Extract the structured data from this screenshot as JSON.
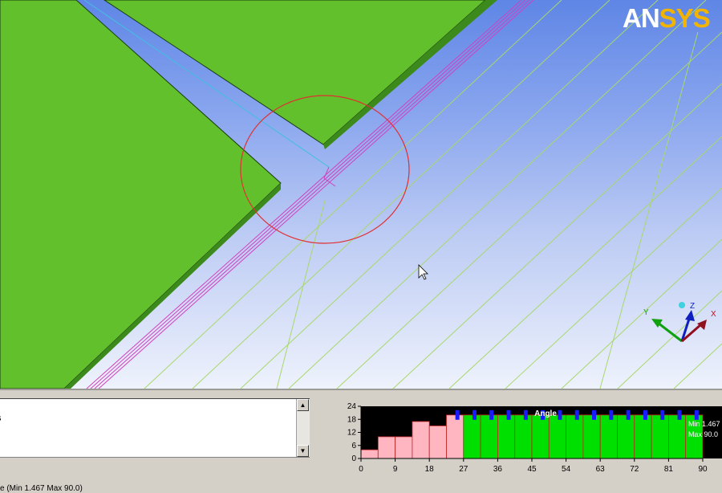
{
  "logo": {
    "part1": "AN",
    "part2": "SYS"
  },
  "log": {
    "line1": "s"
  },
  "status": {
    "text": "e (Min 1.467 Max 90.0)"
  },
  "chart_data": {
    "type": "bar",
    "title": "Angle",
    "x_ticks": [
      0,
      9,
      18,
      27,
      36,
      45,
      54,
      63,
      72,
      81,
      90
    ],
    "y_ticks": [
      0,
      6,
      12,
      18,
      24
    ],
    "xlim": [
      0,
      90
    ],
    "ylim": [
      0,
      24
    ],
    "bins": [
      {
        "from": 0,
        "to": 4.5,
        "value": 4,
        "color": "pink"
      },
      {
        "from": 4.5,
        "to": 9,
        "value": 10,
        "color": "pink"
      },
      {
        "from": 9,
        "to": 13.5,
        "value": 10,
        "color": "pink"
      },
      {
        "from": 13.5,
        "to": 18,
        "value": 17,
        "color": "pink"
      },
      {
        "from": 18,
        "to": 22.5,
        "value": 15,
        "color": "pink"
      },
      {
        "from": 22.5,
        "to": 27,
        "value": 20,
        "color": "pink"
      },
      {
        "from": 27,
        "to": 31.5,
        "value": 20,
        "color": "green"
      },
      {
        "from": 31.5,
        "to": 36,
        "value": 20,
        "color": "green"
      },
      {
        "from": 36,
        "to": 40.5,
        "value": 20,
        "color": "green"
      },
      {
        "from": 40.5,
        "to": 45,
        "value": 20,
        "color": "green"
      },
      {
        "from": 45,
        "to": 49.5,
        "value": 20,
        "color": "green"
      },
      {
        "from": 49.5,
        "to": 54,
        "value": 20,
        "color": "green"
      },
      {
        "from": 54,
        "to": 58.5,
        "value": 20,
        "color": "green"
      },
      {
        "from": 58.5,
        "to": 63,
        "value": 20,
        "color": "green"
      },
      {
        "from": 63,
        "to": 67.5,
        "value": 20,
        "color": "green"
      },
      {
        "from": 67.5,
        "to": 72,
        "value": 20,
        "color": "green"
      },
      {
        "from": 72,
        "to": 76.5,
        "value": 20,
        "color": "green"
      },
      {
        "from": 76.5,
        "to": 81,
        "value": 20,
        "color": "green"
      },
      {
        "from": 81,
        "to": 85.5,
        "value": 20,
        "color": "green"
      },
      {
        "from": 85.5,
        "to": 90,
        "value": 20,
        "color": "green"
      }
    ],
    "min_label": "Min 1.467",
    "max_label": "Max 90.0",
    "colors": {
      "pink": "#ffb6c1",
      "green": "#00e000",
      "background": "#000000",
      "marker": "#1a1aff"
    }
  },
  "triad": {
    "x_label": "X",
    "y_label": "Y",
    "z_label": "Z"
  }
}
